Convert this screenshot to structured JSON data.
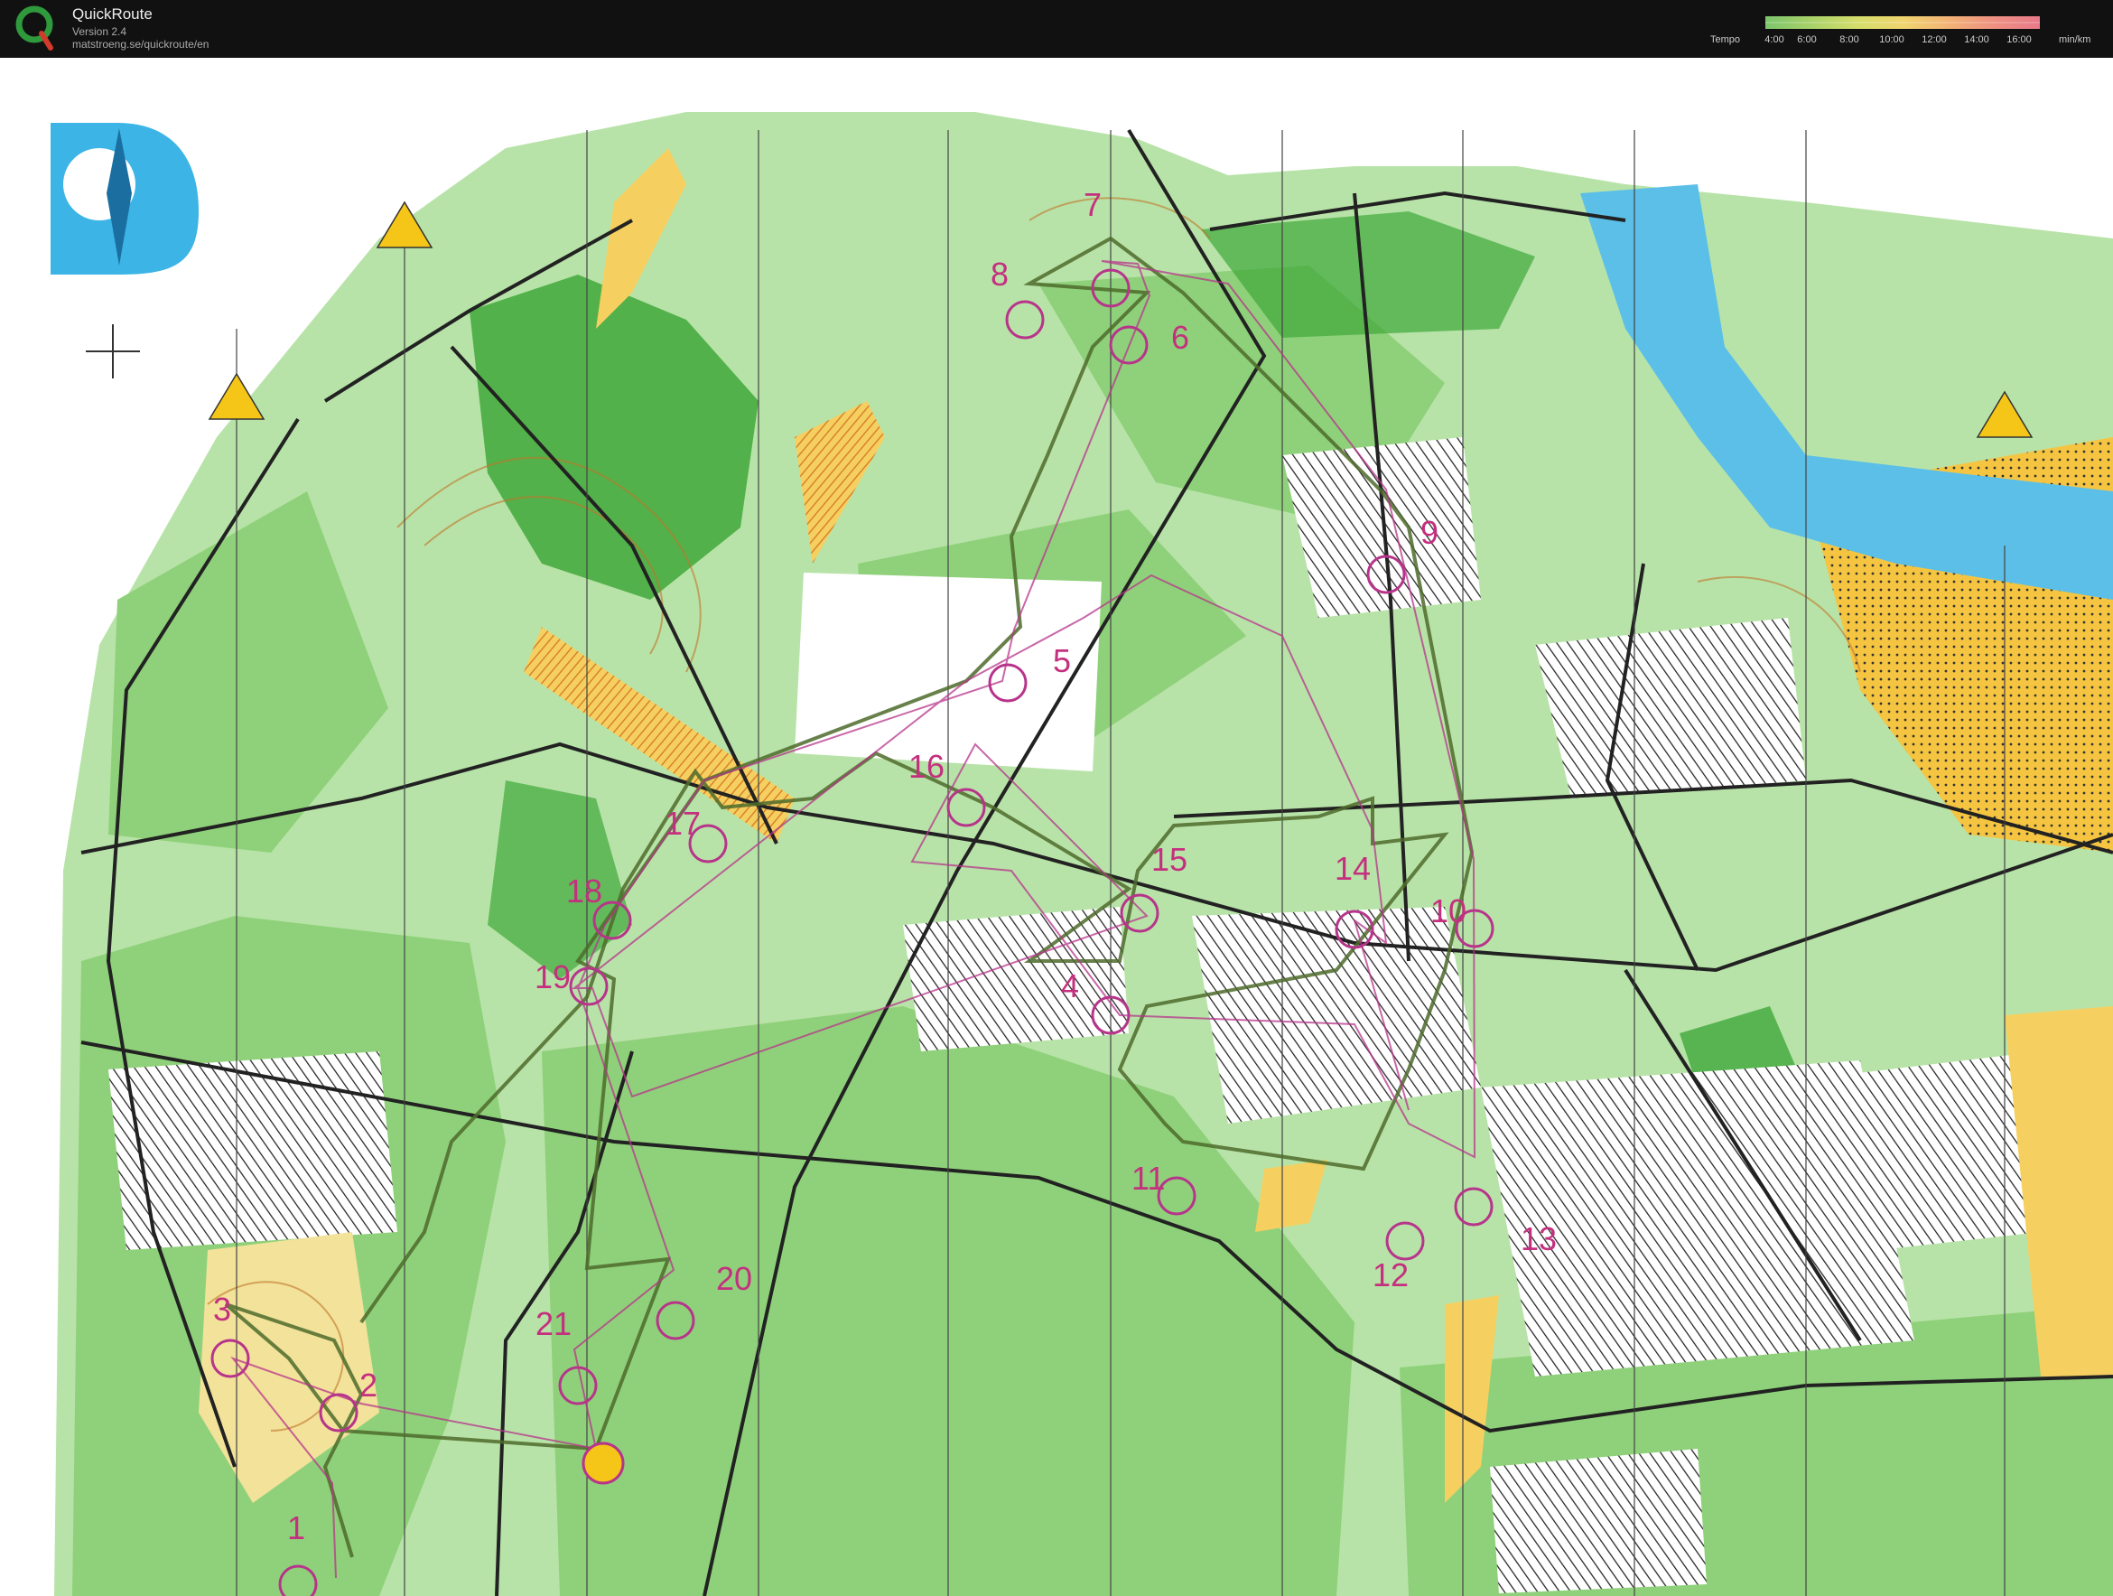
{
  "app": {
    "title": "QuickRoute",
    "version": "Version 2.4",
    "url": "matstroeng.se/quickroute/en"
  },
  "legend": {
    "label": "Tempo",
    "ticks": [
      "4:00",
      "6:00",
      "8:00",
      "10:00",
      "12:00",
      "14:00",
      "16:00"
    ],
    "unit": "min/km",
    "colors": [
      "#7cc46b",
      "#a9d26a",
      "#d6dd6b",
      "#f0d56f",
      "#f2b276",
      "#ee8f82",
      "#e87a8a"
    ]
  },
  "map": {
    "colors": {
      "forest": "#8fd17a",
      "dark_forest": "#3fa83a",
      "open": "#f5d060",
      "water": "#5bbfe8",
      "contour": "#c0762b",
      "course": "#b7348b",
      "route": "#4d6b2b"
    },
    "controls": [
      {
        "label": "1"
      },
      {
        "label": "2"
      },
      {
        "label": "3"
      },
      {
        "label": "4"
      },
      {
        "label": "5"
      },
      {
        "label": "6"
      },
      {
        "label": "7"
      },
      {
        "label": "8"
      },
      {
        "label": "9"
      },
      {
        "label": "10"
      },
      {
        "label": "11"
      },
      {
        "label": "12"
      },
      {
        "label": "13"
      },
      {
        "label": "14"
      },
      {
        "label": "15"
      },
      {
        "label": "16"
      },
      {
        "label": "17"
      },
      {
        "label": "18"
      },
      {
        "label": "19"
      },
      {
        "label": "20"
      },
      {
        "label": "21"
      }
    ]
  }
}
